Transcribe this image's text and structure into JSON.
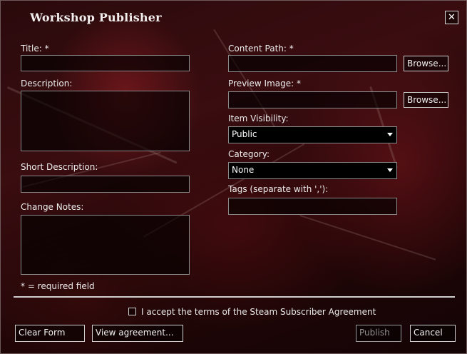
{
  "window": {
    "title": "Workshop Publisher",
    "close_glyph": "✕"
  },
  "labels": {
    "title": "Title: *",
    "description": "Description:",
    "short_description": "Short Description:",
    "change_notes": "Change Notes:",
    "required_note": "* = required field",
    "content_path": "Content Path: *",
    "preview_image": "Preview Image: *",
    "item_visibility": "Item Visibility:",
    "category": "Category:",
    "tags": "Tags (separate with ','):"
  },
  "fields": {
    "title_value": "",
    "description_value": "",
    "short_description_value": "",
    "change_notes_value": "",
    "content_path_value": "",
    "preview_image_value": "",
    "tags_value": ""
  },
  "selects": {
    "item_visibility": "Public",
    "category": "None"
  },
  "buttons": {
    "browse_content": "Browse...",
    "browse_preview": "Browse...",
    "clear_form": "Clear Form",
    "view_agreement": "View agreement...",
    "publish": "Publish",
    "cancel": "Cancel"
  },
  "agreement": {
    "checked": false,
    "text": "I accept the terms of the Steam Subscriber Agreement"
  },
  "icons": {
    "close": "close-icon",
    "dropdown": "chevron-down-icon"
  },
  "colors": {
    "accent": "#3a0d10",
    "border": "#8a8a8a",
    "text": "#ececec",
    "disabled_text": "#8f8f8f"
  }
}
